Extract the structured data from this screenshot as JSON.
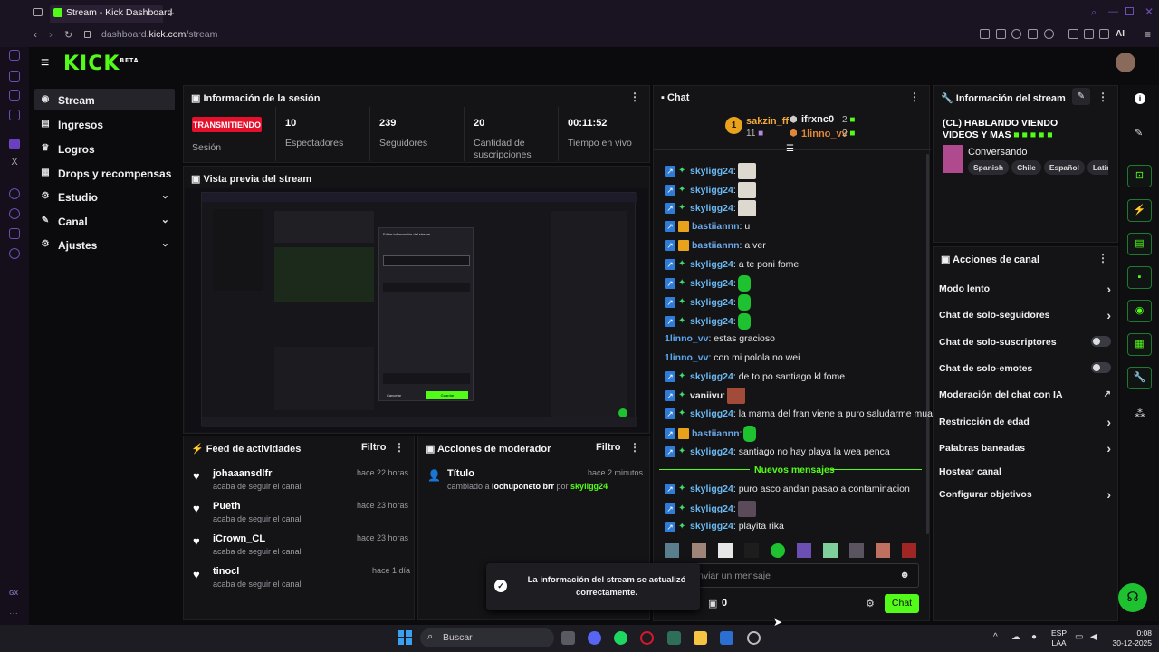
{
  "browser": {
    "tab_title": "Stream - Kick Dashboard",
    "url_host": "dashboard.",
    "url_bold": "kick.com",
    "url_path": "/stream",
    "ai_label": "AI"
  },
  "header": {
    "logo": "KICK",
    "beta": "BETA"
  },
  "sidebar": {
    "items": [
      {
        "label": "Stream",
        "icon": "broadcast-icon"
      },
      {
        "label": "Ingresos",
        "icon": "wallet-icon"
      },
      {
        "label": "Logros",
        "icon": "trophy-icon"
      },
      {
        "label": "Drops y recompensas",
        "icon": "drops-icon"
      },
      {
        "label": "Estudio",
        "icon": "studio-icon"
      },
      {
        "label": "Canal",
        "icon": "channel-icon"
      },
      {
        "label": "Ajustes",
        "icon": "gear-icon"
      }
    ]
  },
  "session": {
    "title": "Información de la sesión",
    "status_badge": "TRANSMITIENDO",
    "status_label": "Sesión",
    "stats": [
      {
        "value": "10",
        "label": "Espectadores"
      },
      {
        "value": "239",
        "label": "Seguidores"
      },
      {
        "value": "20",
        "label": "Cantidad de suscripciones"
      },
      {
        "value": "00:11:52",
        "label": "Tiempo en vivo"
      }
    ]
  },
  "preview": {
    "title": "Vista previa del stream",
    "modal_title": "Editar información del stream",
    "modal_cancel": "Cancelar",
    "modal_save": "Guardar"
  },
  "activity": {
    "title": "Feed de actividades",
    "filter": "Filtro",
    "items": [
      {
        "user": "johaaansdlfr",
        "text": "acaba de seguir el canal",
        "time": "hace 22 horas"
      },
      {
        "user": "Pueth",
        "text": "acaba de seguir el canal",
        "time": "hace 23 horas"
      },
      {
        "user": "iCrown_CL",
        "text": "acaba de seguir el canal",
        "time": "hace 23 horas"
      },
      {
        "user": "tinocl",
        "text": "acaba de seguir el canal",
        "time": "hace 1 día"
      }
    ]
  },
  "mod_actions": {
    "title": "Acciones de moderador",
    "filter": "Filtro",
    "item": {
      "label": "Título",
      "time": "hace 2 minutos",
      "prefix": "cambiado a ",
      "value": "lochuponeto brr",
      "by": " por ",
      "moderator": "skyligg24"
    }
  },
  "chat": {
    "title": "Chat",
    "leaderboard": {
      "first_user": "sakzin_ff",
      "first_count": "11",
      "second_user": "ifrxnc0",
      "second_count": "2",
      "third_user": "1linno_vv",
      "third_count": "2",
      "rank": "1"
    },
    "messages": [
      {
        "user": "skyligg24",
        "text": ":",
        "kind": "green",
        "emote": "l"
      },
      {
        "user": "skyligg24",
        "text": ":",
        "kind": "green",
        "emote": "l"
      },
      {
        "user": "skyligg24",
        "text": ":",
        "kind": "green",
        "emote": "l"
      },
      {
        "user": "bastiiannn",
        "text": ": u",
        "kind": "crown"
      },
      {
        "user": "bastiiannn",
        "text": ": a ver",
        "kind": "crown"
      },
      {
        "user": "skyligg24",
        "text": ": a te poni fome",
        "kind": "green"
      },
      {
        "user": "skyligg24",
        "text": ":",
        "kind": "green",
        "emote": "g"
      },
      {
        "user": "skyligg24",
        "text": ":",
        "kind": "green",
        "emote": "g"
      },
      {
        "user": "skyligg24",
        "text": ":",
        "kind": "green",
        "emote": "g"
      },
      {
        "user": "1linno_vv",
        "text": ": estas gracioso",
        "kind": "plain"
      },
      {
        "user": "1linno_vv",
        "text": ": con mi polola no wei",
        "kind": "plain"
      },
      {
        "user": "skyligg24",
        "text": ": de to po santiago kl fome",
        "kind": "green"
      },
      {
        "user": "vaniivu",
        "text": ":",
        "kind": "vaniivu",
        "emote": "r"
      },
      {
        "user": "skyligg24",
        "text": ": la mama del fran viene a puro saludarme muaa",
        "kind": "green"
      },
      {
        "user": "bastiiannn",
        "text": ":",
        "kind": "crown",
        "emote": "g"
      },
      {
        "user": "skyligg24",
        "text": ": santiago no hay playa la wea penca",
        "kind": "green"
      }
    ],
    "new_messages_label": "Nuevos mensajes",
    "new_messages": [
      {
        "user": "skyligg24",
        "text": ": puro asco andan pasao a contaminacion"
      },
      {
        "user": "skyligg24",
        "text": ":",
        "emote": "d"
      },
      {
        "user": "skyligg24",
        "text": ": playita rika"
      }
    ],
    "input_placeholder": "Enviar un mensaje",
    "points": "0",
    "send_button": "Chat"
  },
  "stream_info": {
    "title": "Información del stream",
    "stream_title": "(CL) HABLANDO VIENDO VIDEOS Y MAS",
    "category": "Conversando",
    "tags": [
      "Spanish",
      "Chile",
      "Español",
      "Latino"
    ]
  },
  "channel_actions": {
    "title": "Acciones de canal",
    "items": [
      {
        "label": "Modo lento",
        "control": "arrow"
      },
      {
        "label": "Chat de solo-seguidores",
        "control": "arrow"
      },
      {
        "label": "Chat de solo-suscriptores",
        "control": "toggle"
      },
      {
        "label": "Chat de solo-emotes",
        "control": "toggle"
      },
      {
        "label": "Moderación del chat con IA",
        "control": "external"
      },
      {
        "label": "Restricción de edad",
        "control": "arrow"
      },
      {
        "label": "Palabras baneadas",
        "control": "arrow"
      },
      {
        "label": "Hostear canal",
        "control": "none"
      },
      {
        "label": "Configurar objetivos",
        "control": "arrow"
      }
    ]
  },
  "toast": {
    "text": "La información del stream se actualizó correctamente."
  },
  "taskbar": {
    "search": "Buscar",
    "lang_top": "ESP",
    "lang_bottom": "LAA",
    "time": "0:08",
    "date": "30-12-2025"
  },
  "os_sidebar_label": "GX",
  "colors": {
    "brand": "#53fc18",
    "live": "#e5112c",
    "chat_badge": "#2e7bd8"
  }
}
